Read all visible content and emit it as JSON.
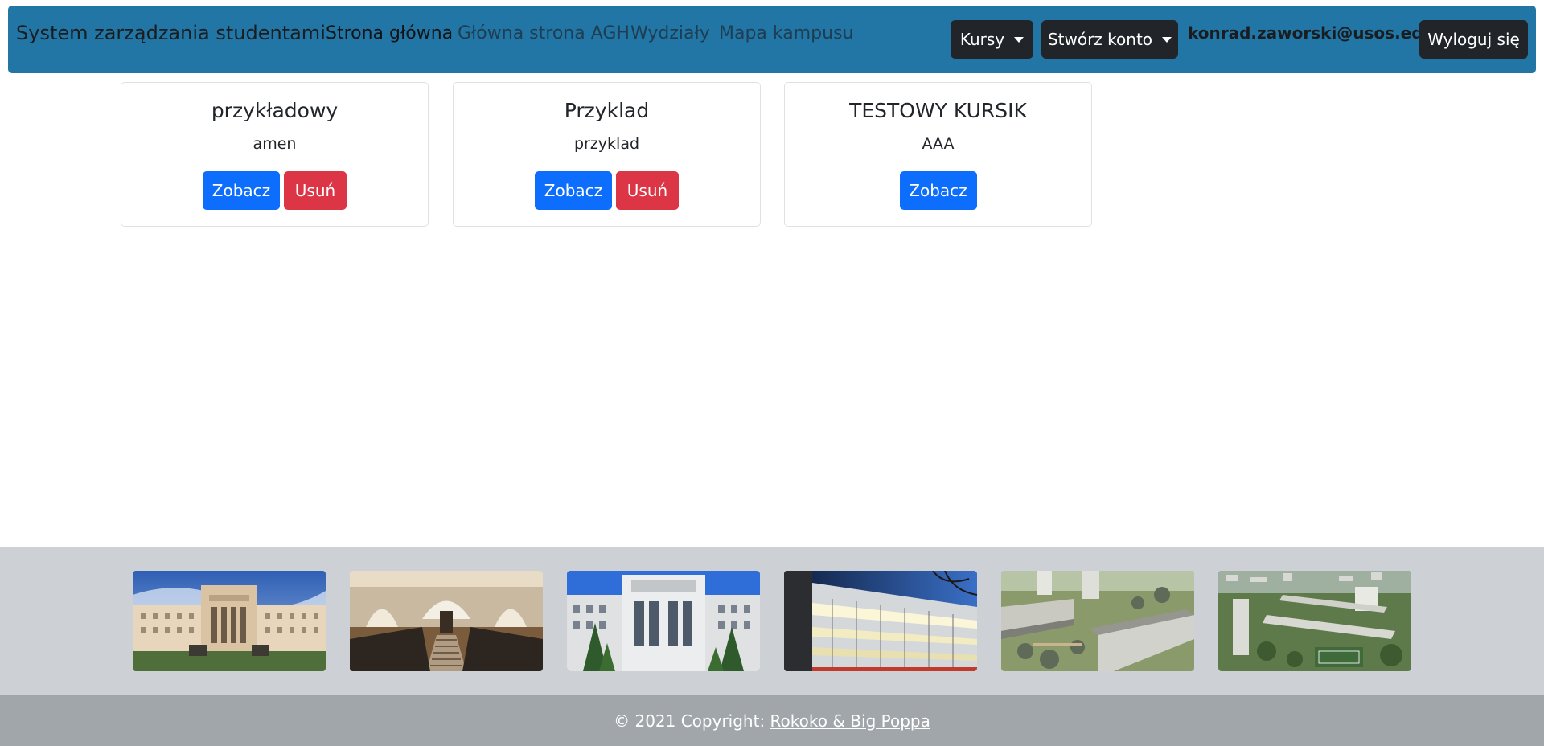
{
  "navbar": {
    "brand": "System zarządzania studentami",
    "links": [
      "Strona główna",
      "Główna strona AGH",
      "Wydziały",
      "Mapa kampusu"
    ],
    "courses_dropdown": "Kursy",
    "create_account_dropdown": "Stwórz konto",
    "user_email": "konrad.zaworski@usos.edu.pl",
    "logout": "Wyloguj się"
  },
  "courses": [
    {
      "title": "przykładowy",
      "description": "amen",
      "view_label": "Zobacz",
      "delete_label": "Usuń"
    },
    {
      "title": "Przyklad",
      "description": "przyklad",
      "view_label": "Zobacz",
      "delete_label": "Usuń"
    },
    {
      "title": "TESTOWY KURSIK",
      "description": "AAA",
      "view_label": "Zobacz"
    }
  ],
  "footer": {
    "copyright_prefix": "© 2021 Copyright: ",
    "copyright_link": "Rokoko & Big Poppa"
  },
  "colors": {
    "navbar_bg": "#2276a5",
    "primary": "#0d6efd",
    "danger": "#dc3545",
    "dark": "#212529",
    "footer_gallery_bg": "#cdd0d4",
    "footer_bottom_bg": "#a1a6aa"
  }
}
